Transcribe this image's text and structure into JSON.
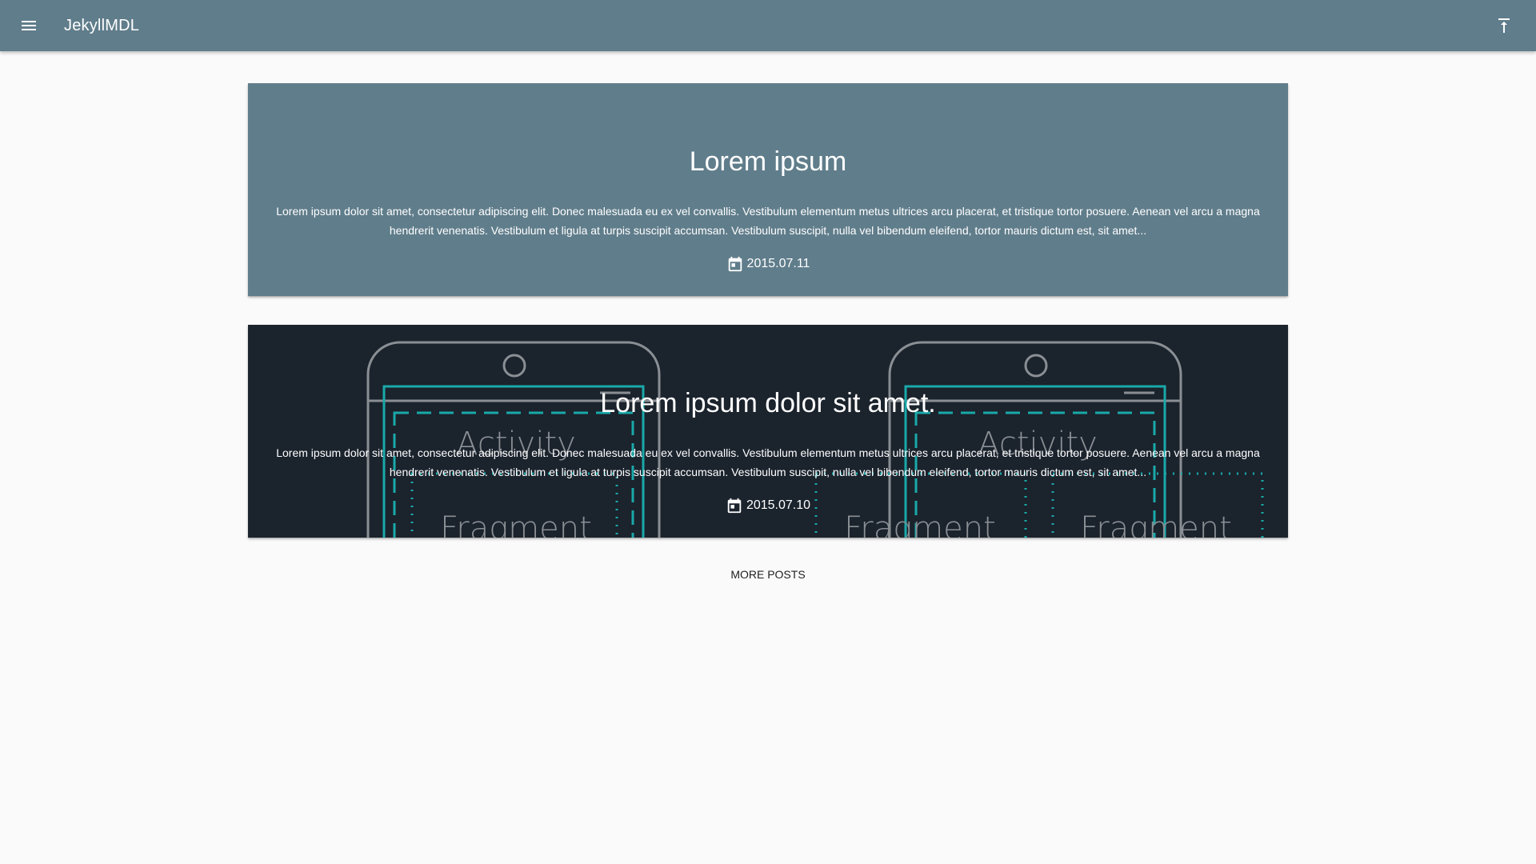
{
  "header": {
    "title": "JekyllMDL",
    "menu_icon": "menu-icon",
    "top_icon": "vertical-align-top-icon",
    "background": "#607d8b"
  },
  "posts": [
    {
      "title": "Lorem ipsum",
      "excerpt_line1": "Lorem ipsum dolor sit amet, consectetur adipiscing elit. Donec malesuada eu ex vel convallis. Vestibulum elementum metus ultrices arcu placerat, et tristique tortor posuere. Aenean vel arcu a magna",
      "excerpt_line2": "hendrerit venenatis. Vestibulum et ligula at turpis suscipit accumsan. Vestibulum suscipit, nulla vel bibendum eleifend, tortor mauris dictum est, sit amet...",
      "date": "2015.07.11",
      "background": "#607d8b"
    },
    {
      "title": "Lorem ipsum dolor sit amet.",
      "excerpt_line1": "Lorem ipsum dolor sit amet, consectetur adipiscing elit. Donec malesuada eu ex vel convallis. Vestibulum elementum metus ultrices arcu placerat, et tristique tortor posuere. Aenean vel arcu a magna",
      "excerpt_line2": "hendrerit venenatis. Vestibulum et ligula at turpis suscipit accumsan. Vestibulum suscipit, nulla vel bibendum eleifend, tortor mauris dictum est, sit amet...",
      "date": "2015.07.10",
      "background": "#1b232d",
      "image_labels": {
        "activity_left": "Activity",
        "fragment_left": "Fragment",
        "activity_right": "Activity",
        "fragment_right_1": "Fragment",
        "fragment_right_2": "Fragment"
      }
    }
  ],
  "more_posts_label": "More posts"
}
